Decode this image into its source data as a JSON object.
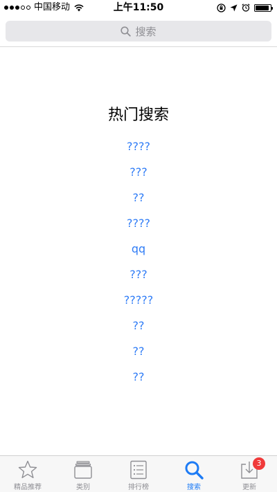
{
  "status_bar": {
    "carrier": "中国移动",
    "time": "上午11:50",
    "battery_level": 0.9
  },
  "search": {
    "placeholder": "搜索"
  },
  "hot_search": {
    "title": "热门搜索",
    "items": [
      "????",
      "???",
      "??",
      "????",
      "qq",
      "???",
      "?????",
      "??",
      "??",
      "??"
    ]
  },
  "tab_bar": {
    "tabs": [
      {
        "label": "精品推荐",
        "icon": "star-icon"
      },
      {
        "label": "类别",
        "icon": "categories-icon"
      },
      {
        "label": "排行榜",
        "icon": "list-icon"
      },
      {
        "label": "搜索",
        "icon": "search-icon"
      },
      {
        "label": "更新",
        "icon": "download-icon",
        "badge": "3"
      }
    ],
    "active_index": 3
  },
  "colors": {
    "accent": "#1d7bf5",
    "link": "#2f7cf6",
    "badge": "#f03a3a",
    "inactive": "#8e8e93"
  }
}
